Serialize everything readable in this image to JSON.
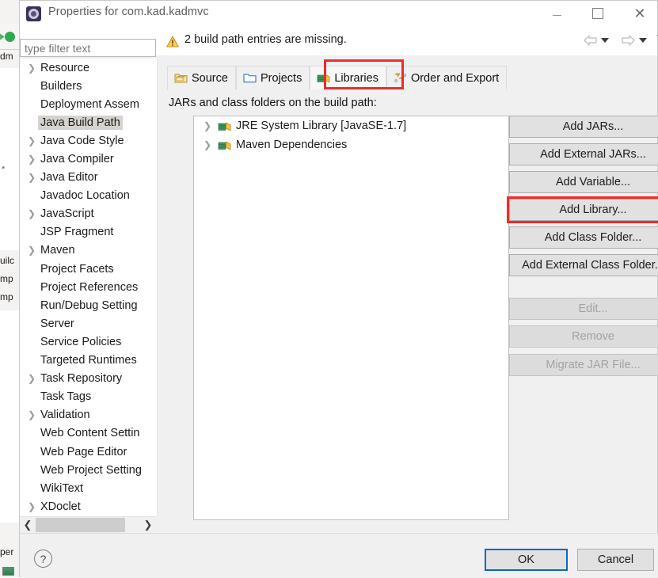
{
  "background": {
    "tab_label": "dm",
    "code_lines": [
      "uilc",
      "mp",
      "mp"
    ],
    "bottom_label": "per",
    "marker": "*"
  },
  "titlebar": {
    "icon": "eclipse-gear-icon",
    "title": "Properties for com.kad.kadmvc",
    "minimize": "minimize-icon",
    "maximize": "maximize-icon",
    "close": "close-icon"
  },
  "message": {
    "icon": "warning-triangle-icon",
    "text": "2 build path entries are missing."
  },
  "nav": {
    "back": "back-arrow-icon",
    "back_menu": "chevron-down-icon",
    "forward": "forward-arrow-icon",
    "forward_menu": "chevron-down-icon",
    "overflow": "chevron-down-icon"
  },
  "sidebar": {
    "filter_placeholder": "type filter text",
    "filter_value": "",
    "selected": "Java Build Path",
    "items": [
      {
        "label": "Resource",
        "expandable": true,
        "selected": false
      },
      {
        "label": "Builders",
        "expandable": false,
        "selected": false
      },
      {
        "label": "Deployment Assem",
        "expandable": false,
        "selected": false
      },
      {
        "label": "Java Build Path",
        "expandable": false,
        "selected": true
      },
      {
        "label": "Java Code Style",
        "expandable": true,
        "selected": false
      },
      {
        "label": "Java Compiler",
        "expandable": true,
        "selected": false
      },
      {
        "label": "Java Editor",
        "expandable": true,
        "selected": false
      },
      {
        "label": "Javadoc Location",
        "expandable": false,
        "selected": false
      },
      {
        "label": "JavaScript",
        "expandable": true,
        "selected": false
      },
      {
        "label": "JSP Fragment",
        "expandable": false,
        "selected": false
      },
      {
        "label": "Maven",
        "expandable": true,
        "selected": false
      },
      {
        "label": "Project Facets",
        "expandable": false,
        "selected": false
      },
      {
        "label": "Project References",
        "expandable": false,
        "selected": false
      },
      {
        "label": "Run/Debug Setting",
        "expandable": false,
        "selected": false
      },
      {
        "label": "Server",
        "expandable": false,
        "selected": false
      },
      {
        "label": "Service Policies",
        "expandable": false,
        "selected": false
      },
      {
        "label": "Targeted Runtimes",
        "expandable": false,
        "selected": false
      },
      {
        "label": "Task Repository",
        "expandable": true,
        "selected": false
      },
      {
        "label": "Task Tags",
        "expandable": false,
        "selected": false
      },
      {
        "label": "Validation",
        "expandable": true,
        "selected": false
      },
      {
        "label": "Web Content Settin",
        "expandable": false,
        "selected": false
      },
      {
        "label": "Web Page Editor",
        "expandable": false,
        "selected": false
      },
      {
        "label": "Web Project Setting",
        "expandable": false,
        "selected": false
      },
      {
        "label": "WikiText",
        "expandable": false,
        "selected": false
      },
      {
        "label": "XDoclet",
        "expandable": true,
        "selected": false
      }
    ],
    "scrollbar": {
      "left_arrow": "chevron-left-icon",
      "right_arrow": "chevron-right-icon"
    }
  },
  "tabs": [
    {
      "label": "Source",
      "icon": "source-folder-icon",
      "active": false
    },
    {
      "label": "Projects",
      "icon": "projects-folder-icon",
      "active": false
    },
    {
      "label": "Libraries",
      "icon": "library-books-icon",
      "active": true
    },
    {
      "label": "Order and Export",
      "icon": "order-export-icon",
      "active": false
    }
  ],
  "main": {
    "list_label": "JARs and class folders on the build path:",
    "entries": [
      {
        "label": "JRE System Library [JavaSE-1.7]",
        "icon": "library-books-icon",
        "expandable": true
      },
      {
        "label": "Maven Dependencies",
        "icon": "library-books-icon",
        "expandable": true
      }
    ]
  },
  "buttons": [
    {
      "label": "Add JARs...",
      "disabled": false,
      "highlighted": false
    },
    {
      "label": "Add External JARs...",
      "disabled": false,
      "highlighted": false
    },
    {
      "label": "Add Variable...",
      "disabled": false,
      "highlighted": false
    },
    {
      "label": "Add Library...",
      "disabled": false,
      "highlighted": true
    },
    {
      "label": "Add Class Folder...",
      "disabled": false,
      "highlighted": false
    },
    {
      "label": "Add External Class Folder...",
      "disabled": false,
      "highlighted": false
    },
    {
      "label": "Edit...",
      "disabled": true,
      "highlighted": false
    },
    {
      "label": "Remove",
      "disabled": true,
      "highlighted": false
    },
    {
      "label": "Migrate JAR File...",
      "disabled": true,
      "highlighted": false
    }
  ],
  "footer": {
    "help": "?",
    "ok": "OK",
    "cancel": "Cancel"
  },
  "colors": {
    "highlight_red": "#ef2b2b",
    "focus_blue": "#0a67c8",
    "selection_gray": "#d6d2cd",
    "warning_yellow": "#f0b323"
  }
}
